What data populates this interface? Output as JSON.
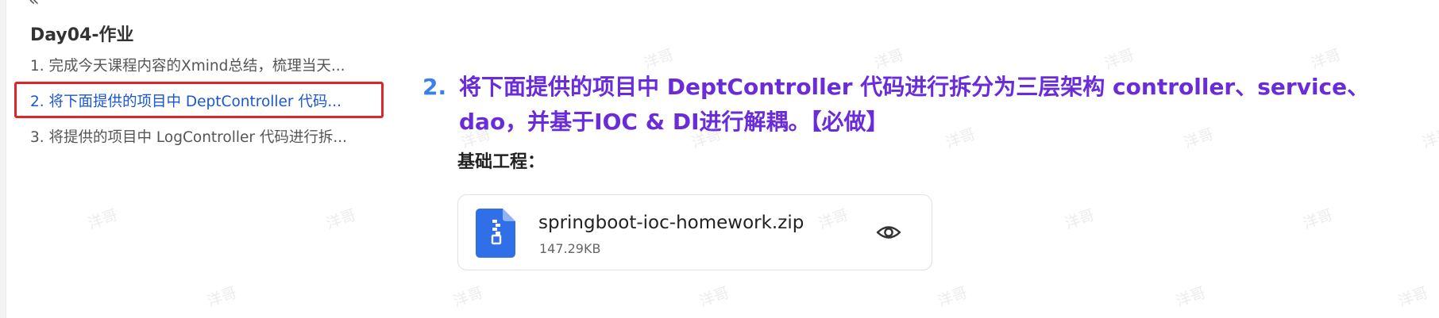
{
  "sidebar": {
    "collapse_symbol": "‹‹",
    "title": "Day04-作业",
    "items": [
      {
        "label": "1. 完成今天课程内容的Xmind总结，梳理当天..."
      },
      {
        "label": "2. 将下面提供的项目中 DeptController 代码..."
      },
      {
        "label": "3. 将提供的项目中 LogController 代码进行拆..."
      }
    ]
  },
  "content": {
    "heading_number": "2.",
    "heading_line1": "将下面提供的项目中 DeptController 代码进行拆分为三层架构 controller、service、",
    "heading_line2": "dao，并基于IOC & DI进行解耦。【必做】",
    "subheading": "基础工程：",
    "attachment": {
      "file_name": "springboot-ioc-homework.zip",
      "file_size": "147.29KB",
      "icon": "zip-file-icon",
      "action_icon": "eye-icon"
    }
  },
  "watermark_text": "洋哥",
  "colors": {
    "heading": "#6a2bd9",
    "heading_number": "#3a7ff0",
    "active_item": "#1a56d6",
    "highlight_border": "#e0242b",
    "file_icon": "#2f6fe8"
  }
}
